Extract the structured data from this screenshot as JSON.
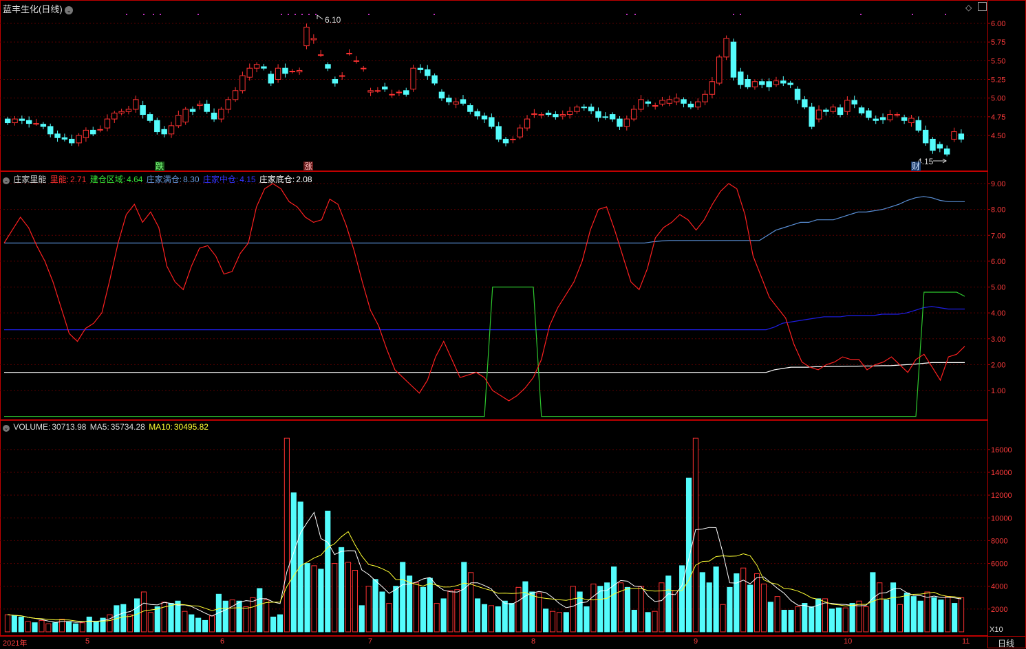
{
  "title": "蓝丰生化(日线)",
  "colors": {
    "bg": "#000000",
    "frame": "#c00000",
    "grid": "#5a0000",
    "up": "#ff3232",
    "down": "#54fcfc",
    "axis_text": "#ff3b3b",
    "zhuli": "#ff2020",
    "jiancang": "#2ec82e",
    "mancang": "#5a8fd6",
    "zhongcang": "#1e1ee8",
    "dicang": "#ffffff",
    "ma5": "#ffffff",
    "ma10": "#ffff33"
  },
  "price_panel": {
    "yticks": [
      "6.00",
      "5.75",
      "5.50",
      "5.25",
      "5.00",
      "4.75",
      "4.50"
    ],
    "high_label": "6.10",
    "low_label": "4.15",
    "marks": {
      "die": "跌",
      "zhang": "涨",
      "cai": "财"
    }
  },
  "indicator_panel": {
    "name": "庄家里能",
    "items": [
      {
        "label": "里能:",
        "value": "2.71"
      },
      {
        "label": "建仓区域:",
        "value": "4.64"
      },
      {
        "label": "庄家满仓:",
        "value": "8.30"
      },
      {
        "label": "庄家中仓:",
        "value": "4.15"
      },
      {
        "label": "庄家底仓:",
        "value": "2.08"
      }
    ],
    "yticks": [
      "9.00",
      "8.00",
      "7.00",
      "6.00",
      "5.00",
      "4.00",
      "3.00",
      "2.00",
      "1.00"
    ]
  },
  "volume_panel": {
    "items": [
      {
        "label": "VOLUME:",
        "value": "30713.98"
      },
      {
        "label": "MA5:",
        "value": "35734.28"
      },
      {
        "label": "MA10:",
        "value": "30495.82"
      }
    ],
    "yticks": [
      "16000",
      "14000",
      "12000",
      "10000",
      "8000",
      "6000",
      "4000",
      "2000"
    ],
    "unit": "X10"
  },
  "x_axis": {
    "labels": [
      "2021年",
      "5",
      "6",
      "7",
      "8",
      "9",
      "10",
      "11"
    ],
    "period": "日线"
  },
  "chart_data": {
    "type": "candlestick",
    "x": "trading days, Apr 2021 – early Nov 2021",
    "open": [
      4.72,
      4.67,
      4.72,
      4.7,
      4.66,
      4.65,
      4.62,
      4.52,
      4.47,
      4.45,
      4.4,
      4.47,
      4.57,
      4.58,
      4.6,
      4.72,
      4.8,
      4.82,
      4.85,
      4.9,
      4.78,
      4.7,
      4.58,
      4.52,
      4.63,
      4.68,
      4.85,
      4.9,
      4.92,
      4.8,
      4.72,
      4.85,
      4.98,
      5.1,
      5.28,
      5.4,
      5.42,
      5.32,
      5.25,
      5.4,
      5.36,
      5.35,
      5.7,
      5.78,
      5.58,
      5.45,
      5.25,
      5.3,
      5.6,
      5.5,
      5.4,
      5.08,
      5.1,
      5.15,
      5.05,
      5.08,
      5.1,
      5.12,
      5.4,
      5.38,
      5.3,
      5.08,
      5.0,
      4.92,
      4.98,
      4.9,
      4.82,
      4.76,
      4.74,
      4.62,
      4.45,
      4.45,
      4.48,
      4.6,
      4.78,
      4.78,
      4.8,
      4.78,
      4.76,
      4.78,
      4.82,
      4.88,
      4.88,
      4.82,
      4.75,
      4.78,
      4.72,
      4.62,
      4.72,
      4.85,
      4.95,
      4.9,
      4.92,
      4.93,
      4.95,
      4.98,
      4.92,
      4.88,
      4.95,
      5.05,
      5.2,
      5.55,
      5.75,
      5.35,
      5.25,
      5.15,
      5.22,
      5.22,
      5.18,
      5.23,
      5.2,
      5.12,
      4.98,
      4.88,
      4.72,
      4.84,
      4.82,
      4.87,
      4.82,
      4.97,
      4.87,
      4.83,
      4.72,
      4.74,
      4.71,
      4.78,
      4.74,
      4.67,
      4.7,
      4.57,
      4.45,
      4.38,
      4.32,
      4.45,
      4.52
    ],
    "close": [
      4.67,
      4.72,
      4.7,
      4.66,
      4.66,
      4.62,
      4.52,
      4.47,
      4.45,
      4.4,
      4.5,
      4.57,
      4.52,
      4.58,
      4.72,
      4.8,
      4.82,
      4.85,
      4.98,
      4.78,
      4.7,
      4.55,
      4.52,
      4.63,
      4.77,
      4.85,
      4.82,
      4.92,
      4.82,
      4.72,
      4.85,
      4.98,
      5.1,
      5.3,
      5.4,
      5.45,
      5.4,
      5.2,
      5.4,
      5.33,
      5.36,
      5.37,
      5.95,
      5.8,
      5.58,
      5.4,
      5.2,
      5.3,
      5.6,
      5.5,
      5.4,
      5.1,
      5.1,
      5.12,
      5.05,
      5.08,
      5.05,
      5.4,
      5.38,
      5.3,
      5.2,
      5.0,
      4.95,
      4.95,
      4.93,
      4.82,
      4.76,
      4.72,
      4.62,
      4.45,
      4.4,
      4.45,
      4.6,
      4.72,
      4.79,
      4.78,
      4.78,
      4.75,
      4.78,
      4.82,
      4.88,
      4.87,
      4.83,
      4.74,
      4.74,
      4.72,
      4.62,
      4.72,
      4.85,
      4.98,
      4.93,
      4.9,
      4.97,
      4.98,
      5.0,
      4.93,
      4.88,
      4.95,
      5.05,
      5.22,
      5.55,
      5.8,
      5.28,
      5.18,
      5.15,
      5.22,
      5.18,
      5.15,
      5.23,
      5.2,
      5.18,
      4.98,
      4.88,
      4.62,
      4.84,
      4.82,
      4.88,
      4.78,
      4.97,
      4.92,
      4.8,
      4.74,
      4.7,
      4.71,
      4.78,
      4.78,
      4.7,
      4.73,
      4.57,
      4.4,
      4.3,
      4.33,
      4.25,
      4.55,
      4.45
    ],
    "zhuli_line": [
      6.7,
      7.2,
      7.7,
      7.3,
      6.6,
      6.0,
      5.2,
      4.2,
      3.2,
      2.9,
      3.4,
      3.6,
      4.0,
      5.3,
      6.7,
      7.8,
      8.2,
      7.5,
      7.9,
      7.3,
      5.8,
      5.2,
      4.9,
      5.8,
      6.5,
      6.6,
      6.2,
      5.5,
      5.6,
      6.3,
      6.7,
      8.1,
      8.8,
      9.0,
      8.8,
      8.3,
      8.1,
      7.7,
      7.5,
      7.6,
      8.4,
      8.2,
      7.4,
      6.4,
      5.2,
      4.1,
      3.5,
      2.6,
      1.8,
      1.5,
      1.2,
      0.9,
      1.4,
      2.3,
      2.9,
      2.2,
      1.5,
      1.6,
      1.7,
      1.5,
      1.0,
      0.8,
      0.6,
      0.8,
      1.1,
      1.5,
      2.2,
      3.5,
      4.2,
      4.7,
      5.2,
      6.0,
      7.2,
      8.0,
      8.1,
      7.2,
      6.2,
      5.2,
      4.9,
      5.7,
      6.9,
      7.3,
      7.5,
      7.8,
      7.6,
      7.2,
      7.6,
      8.2,
      8.7,
      9.0,
      8.8,
      7.8,
      6.2,
      5.4,
      4.6,
      4.2,
      3.8,
      2.8,
      2.1,
      1.9,
      1.8,
      2.0,
      2.1,
      2.3,
      2.2,
      2.2,
      1.8,
      2.0,
      2.1,
      2.3,
      2.0,
      1.7,
      2.2,
      2.4,
      1.9,
      1.4,
      2.3,
      2.4,
      2.71
    ],
    "jiancang_line": [
      0.0,
      0.0,
      0.0,
      0.0,
      0.0,
      0.0,
      0.0,
      0.0,
      0.0,
      0.0,
      0.0,
      0.0,
      0.0,
      0.0,
      0.0,
      0.0,
      0.0,
      0.0,
      0.0,
      0.0,
      0.0,
      0.0,
      0.0,
      0.0,
      0.0,
      0.0,
      0.0,
      0.0,
      0.0,
      0.0,
      0.0,
      0.0,
      0.0,
      0.0,
      0.0,
      0.0,
      0.0,
      0.0,
      0.0,
      0.0,
      0.0,
      0.0,
      0.0,
      0.0,
      0.0,
      0.0,
      0.0,
      0.0,
      0.0,
      0.0,
      0.0,
      0.0,
      0.0,
      0.0,
      0.0,
      0.0,
      0.0,
      0.0,
      0.0,
      0.0,
      5.0,
      5.0,
      5.0,
      5.0,
      5.0,
      5.0,
      0.0,
      0.0,
      0.0,
      0.0,
      0.0,
      0.0,
      0.0,
      0.0,
      0.0,
      0.0,
      0.0,
      0.0,
      0.0,
      0.0,
      0.0,
      0.0,
      0.0,
      0.0,
      0.0,
      0.0,
      0.0,
      0.0,
      0.0,
      0.0,
      0.0,
      0.0,
      0.0,
      0.0,
      0.0,
      0.0,
      0.0,
      0.0,
      0.0,
      0.0,
      0.0,
      0.0,
      0.0,
      0.0,
      0.0,
      0.0,
      0.0,
      0.0,
      0.0,
      0.0,
      0.0,
      0.0,
      0.0,
      4.8,
      4.8,
      4.8,
      4.8,
      4.8,
      4.64
    ],
    "mancang_line": [
      6.7,
      6.7,
      6.7,
      6.7,
      6.7,
      6.7,
      6.7,
      6.7,
      6.7,
      6.7,
      6.7,
      6.7,
      6.7,
      6.7,
      6.7,
      6.7,
      6.7,
      6.7,
      6.7,
      6.7,
      6.7,
      6.7,
      6.7,
      6.7,
      6.7,
      6.7,
      6.7,
      6.7,
      6.7,
      6.7,
      6.7,
      6.7,
      6.7,
      6.7,
      6.7,
      6.7,
      6.7,
      6.7,
      6.7,
      6.7,
      6.7,
      6.7,
      6.7,
      6.7,
      6.7,
      6.7,
      6.7,
      6.7,
      6.7,
      6.7,
      6.7,
      6.7,
      6.7,
      6.7,
      6.7,
      6.7,
      6.7,
      6.7,
      6.7,
      6.7,
      6.7,
      6.7,
      6.7,
      6.7,
      6.7,
      6.7,
      6.7,
      6.7,
      6.7,
      6.7,
      6.7,
      6.7,
      6.7,
      6.7,
      6.7,
      6.7,
      6.7,
      6.7,
      6.7,
      6.75,
      6.78,
      6.8,
      6.8,
      6.8,
      6.8,
      6.8,
      6.8,
      6.8,
      6.8,
      6.8,
      6.8,
      6.8,
      6.8,
      7.0,
      7.2,
      7.3,
      7.4,
      7.5,
      7.5,
      7.6,
      7.6,
      7.6,
      7.7,
      7.8,
      7.9,
      7.9,
      7.95,
      8.0,
      8.1,
      8.2,
      8.35,
      8.45,
      8.5,
      8.45,
      8.35,
      8.3,
      8.3,
      8.3
    ],
    "zhongcang_line": [
      3.35,
      3.35,
      3.35,
      3.35,
      3.35,
      3.35,
      3.35,
      3.35,
      3.35,
      3.35,
      3.35,
      3.35,
      3.35,
      3.35,
      3.35,
      3.35,
      3.35,
      3.35,
      3.35,
      3.35,
      3.35,
      3.35,
      3.35,
      3.35,
      3.35,
      3.35,
      3.35,
      3.35,
      3.35,
      3.35,
      3.35,
      3.35,
      3.35,
      3.35,
      3.35,
      3.35,
      3.35,
      3.35,
      3.35,
      3.35,
      3.35,
      3.35,
      3.35,
      3.35,
      3.35,
      3.35,
      3.35,
      3.35,
      3.35,
      3.35,
      3.35,
      3.35,
      3.35,
      3.35,
      3.35,
      3.35,
      3.35,
      3.35,
      3.35,
      3.35,
      3.35,
      3.35,
      3.35,
      3.35,
      3.35,
      3.35,
      3.35,
      3.35,
      3.35,
      3.35,
      3.35,
      3.35,
      3.35,
      3.35,
      3.35,
      3.35,
      3.35,
      3.35,
      3.35,
      3.35,
      3.35,
      3.35,
      3.35,
      3.35,
      3.35,
      3.35,
      3.35,
      3.35,
      3.35,
      3.35,
      3.35,
      3.35,
      3.35,
      3.45,
      3.6,
      3.65,
      3.7,
      3.75,
      3.8,
      3.85,
      3.85,
      3.85,
      3.9,
      3.9,
      3.9,
      3.9,
      3.95,
      3.95,
      3.95,
      4.0,
      4.1,
      4.2,
      4.25,
      4.2,
      4.15,
      4.15,
      4.15
    ],
    "dicang_line": [
      1.7,
      1.7,
      1.7,
      1.7,
      1.7,
      1.7,
      1.7,
      1.7,
      1.7,
      1.7,
      1.7,
      1.7,
      1.7,
      1.7,
      1.7,
      1.7,
      1.7,
      1.7,
      1.7,
      1.7,
      1.7,
      1.7,
      1.7,
      1.7,
      1.7,
      1.7,
      1.7,
      1.7,
      1.7,
      1.7,
      1.7,
      1.7,
      1.7,
      1.7,
      1.7,
      1.7,
      1.7,
      1.7,
      1.7,
      1.7,
      1.7,
      1.7,
      1.7,
      1.7,
      1.7,
      1.7,
      1.7,
      1.7,
      1.7,
      1.7,
      1.7,
      1.7,
      1.7,
      1.7,
      1.7,
      1.7,
      1.7,
      1.7,
      1.7,
      1.7,
      1.7,
      1.7,
      1.7,
      1.7,
      1.7,
      1.7,
      1.7,
      1.7,
      1.7,
      1.7,
      1.7,
      1.7,
      1.7,
      1.7,
      1.7,
      1.7,
      1.7,
      1.7,
      1.7,
      1.7,
      1.7,
      1.7,
      1.7,
      1.7,
      1.7,
      1.7,
      1.7,
      1.7,
      1.7,
      1.7,
      1.7,
      1.7,
      1.7,
      1.8,
      1.85,
      1.9,
      1.9,
      1.9,
      1.92,
      1.92,
      1.93,
      1.93,
      1.94,
      1.94,
      1.95,
      1.95,
      1.96,
      1.96,
      1.98,
      2.0,
      2.02,
      2.05,
      2.08,
      2.08,
      2.08,
      2.08,
      2.08
    ],
    "volume": [
      1500,
      1400,
      1300,
      900,
      800,
      1000,
      700,
      800,
      1100,
      900,
      700,
      800,
      1300,
      900,
      1200,
      1500,
      2300,
      2400,
      1500,
      2900,
      3500,
      1700,
      2200,
      2600,
      2500,
      2700,
      1800,
      1500,
      1200,
      1000,
      1400,
      3300,
      2700,
      2800,
      2700,
      2200,
      3000,
      3800,
      2800,
      1300,
      1500,
      17000,
      12200,
      11400,
      6000,
      5800,
      5500,
      10600,
      6000,
      7400,
      6100,
      5400,
      2300,
      4000,
      4600,
      3500,
      2500,
      4000,
      6100,
      4900,
      4300,
      3900,
      4700,
      2500,
      2900,
      3600,
      3700,
      6100,
      5200,
      2900,
      2400,
      2300,
      2200,
      2700,
      2500,
      3900,
      4400,
      3500,
      3400,
      2000,
      1800,
      1700,
      1700,
      4000,
      3500,
      2200,
      4200,
      4000,
      4300,
      5700,
      4300,
      3900,
      1900,
      4000,
      1700,
      1800,
      4300,
      4900,
      3600,
      5800,
      13500,
      17000,
      5200,
      4300,
      5700,
      2400,
      3900,
      5100,
      5600,
      4100,
      5100,
      4200,
      2600,
      3100,
      1900,
      1900,
      2200,
      2500,
      2200,
      2900,
      2900,
      2000,
      2100,
      2100,
      2500,
      2700,
      2200,
      5200,
      4300,
      2800,
      4300,
      2400,
      3400,
      3100,
      2700,
      3500,
      3000,
      2800,
      3100,
      2500,
      3000
    ],
    "vol_ma5_note": "MA5 and MA10 lines of volume",
    "ylim_price": [
      4.15,
      6.1
    ],
    "ylim_indicator": [
      0,
      9.5
    ],
    "ylim_volume": [
      0,
      18000
    ]
  }
}
